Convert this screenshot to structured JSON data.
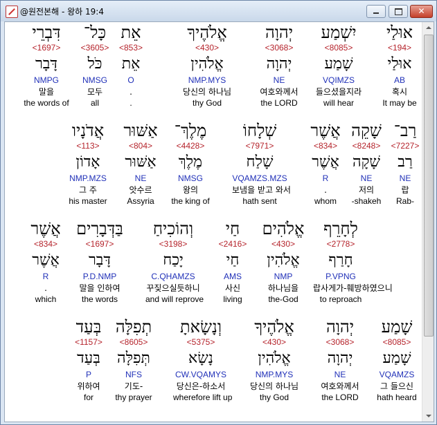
{
  "window": {
    "title": "@원전본해 - 왕하 19:4"
  },
  "rows": [
    {
      "words": [
        {
          "heb": "אוּלַי",
          "strong": "<194>",
          "lemma": "אוּלַי",
          "morph": "AB",
          "kor": "혹시",
          "eng": "It may be"
        },
        {
          "heb": "יִשְׁמַע",
          "strong": "<8085>",
          "lemma": "שָׁמַע",
          "morph": "VQIMZS",
          "kor": "들으셨을지라",
          "eng": "will hear"
        },
        {
          "heb": "יְהוָה",
          "strong": "<3068>",
          "lemma": "יְהוָה",
          "morph": "NE",
          "kor": "여호와께서",
          "eng": "the LORD"
        },
        {
          "heb": "אֱלֹהֶיךָ",
          "strong": "<430>",
          "lemma": "אֱלֹהִין",
          "morph": "NMP.MYS",
          "kor": "당신의 하나님",
          "eng": "thy God"
        },
        {
          "heb": "אֵת",
          "strong": "<853>",
          "lemma": "אֵת",
          "morph": "O",
          "kor": ".",
          "eng": "."
        },
        {
          "heb": "כָּל־",
          "strong": "<3605>",
          "lemma": "כֹּל",
          "morph": "NMSG",
          "kor": "모두",
          "eng": "all"
        },
        {
          "heb": "דִּבְרֵי",
          "strong": "<1697>",
          "lemma": "דָּבָר",
          "morph": "NMPG",
          "kor": "말을",
          "eng": "the words of"
        }
      ]
    },
    {
      "words": [
        {
          "heb": "רַב־",
          "strong": "<7227>",
          "lemma": "רַב",
          "morph": "NE",
          "kor": "랍",
          "eng": "Rab-"
        },
        {
          "heb": "שָׁקֵה",
          "strong": "<8248>",
          "lemma": "שָׁקָה",
          "morph": "NE",
          "kor": "저의",
          "eng": "-shakeh"
        },
        {
          "heb": "אֲשֶׁר",
          "strong": "<834>",
          "lemma": "אֲשֶׁר",
          "morph": "R",
          "kor": ".",
          "eng": "whom"
        },
        {
          "heb": "שְׁלָחוֹ",
          "strong": "<7971>",
          "lemma": "שָׁלַח",
          "morph": "VQAMZS.MZS",
          "kor": "보냄을 받고 와서",
          "eng": "hath sent"
        },
        {
          "heb": "מֶלֶךְ־",
          "strong": "<4428>",
          "lemma": "מֶלֶךְ",
          "morph": "NMSG",
          "kor": "왕의",
          "eng": "the king of"
        },
        {
          "heb": "אַשּׁוּר",
          "strong": "<804>",
          "lemma": "אַשּׁוּר",
          "morph": "NE",
          "kor": "앗수르",
          "eng": "Assyria"
        },
        {
          "heb": "אֲדֹנָיו",
          "strong": "<113>",
          "lemma": "אָדוֹן",
          "morph": "NMP.MZS",
          "kor": "그 주",
          "eng": "his master"
        }
      ]
    },
    {
      "words": [
        {
          "heb": "לְחָרֵף",
          "strong": "<2778>",
          "lemma": "חָרַף",
          "morph": "P.VPNG",
          "kor": "랍사게가-훼방하였으니",
          "eng": "to reproach"
        },
        {
          "heb": "אֱלֹהִים",
          "strong": "<430>",
          "lemma": "אֱלֹהִין",
          "morph": "NMP",
          "kor": "하나님을",
          "eng": "the-God"
        },
        {
          "heb": "חַי",
          "strong": "<2416>",
          "lemma": "חַי",
          "morph": "AMS",
          "kor": "사신",
          "eng": "living"
        },
        {
          "heb": "וְהוֹכִיחַ",
          "strong": "<3198>",
          "lemma": "יָכַח",
          "morph": "C.QHAMZS",
          "kor": "꾸짖으실듯하니",
          "eng": "and will reprove"
        },
        {
          "heb": "בַּדְּבָרִים",
          "strong": "<1697>",
          "lemma": "דָּבָר",
          "morph": "P.D.NMP",
          "kor": "말을 인하여",
          "eng": "the words"
        },
        {
          "heb": "אֲשֶׁר",
          "strong": "<834>",
          "lemma": "אֲשֶׁר",
          "morph": "R",
          "kor": ".",
          "eng": "which"
        }
      ]
    },
    {
      "words": [
        {
          "heb": "שָׁמַע",
          "strong": "<8085>",
          "lemma": "שָׁמַע",
          "morph": "VQAMZS",
          "kor": "그 들으신",
          "eng": "hath heard"
        },
        {
          "heb": "יְהוָה",
          "strong": "<3068>",
          "lemma": "יְהוָה",
          "morph": "NE",
          "kor": "여호와께서",
          "eng": "the LORD"
        },
        {
          "heb": "אֱלֹהֶיךָ",
          "strong": "<430>",
          "lemma": "אֱלֹהִין",
          "morph": "NMP.MYS",
          "kor": "당신의 하나님",
          "eng": "thy God"
        },
        {
          "heb": "וְנָשָׂאתָ",
          "strong": "<5375>",
          "lemma": "נָשָׂא",
          "morph": "CW.VQAMYS",
          "kor": "당신은-하소서",
          "eng": "wherefore lift up"
        },
        {
          "heb": "תְפִלָּה",
          "strong": "<8605>",
          "lemma": "תְּפִלָּה",
          "morph": "NFS",
          "kor": "기도-",
          "eng": "thy prayer"
        },
        {
          "heb": "בְּעַד",
          "strong": "<1157>",
          "lemma": "בְּעַד",
          "morph": "P",
          "kor": "위하여",
          "eng": "for"
        }
      ]
    }
  ]
}
